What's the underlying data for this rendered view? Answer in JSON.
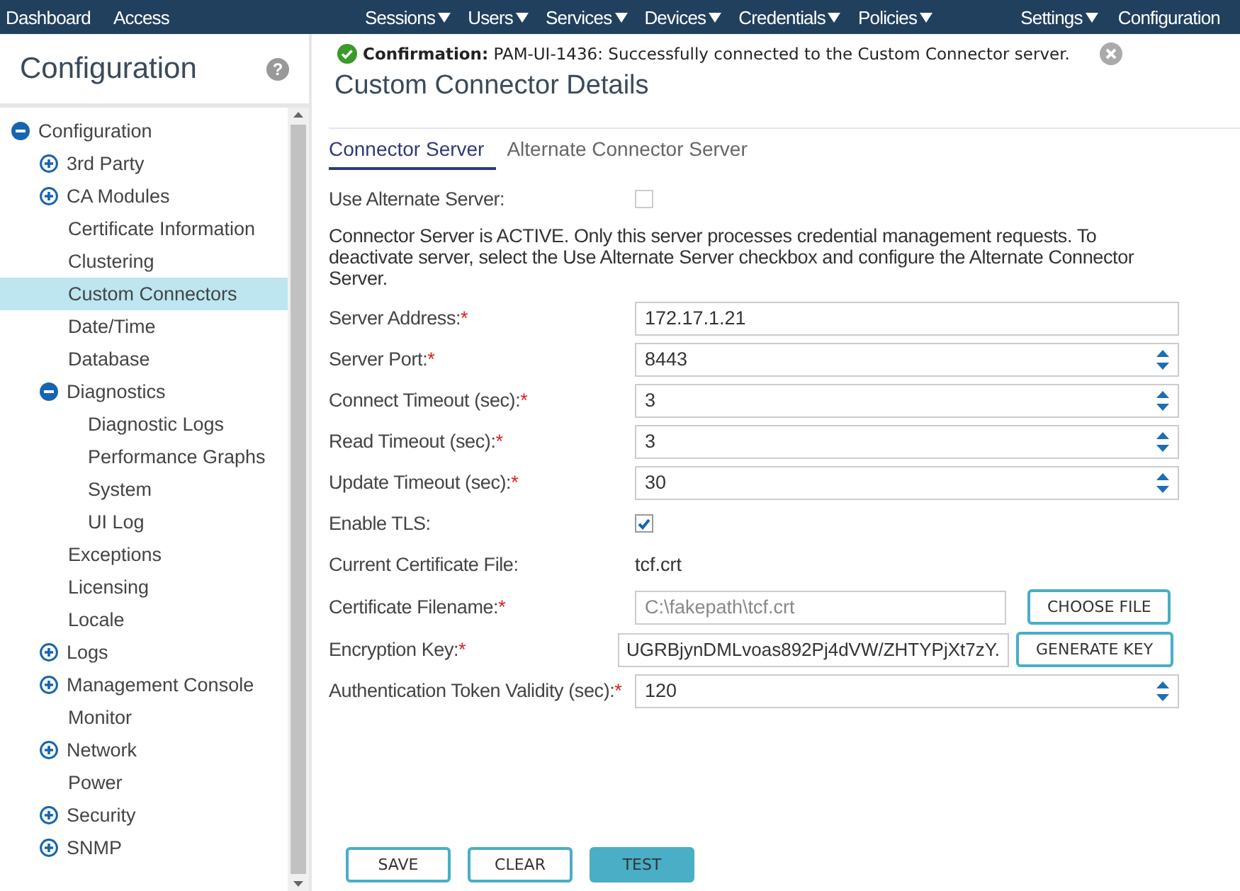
{
  "nav": {
    "left": [
      "Dashboard",
      "Access"
    ],
    "menus": [
      "Sessions",
      "Users",
      "Services",
      "Devices",
      "Credentials",
      "Policies"
    ],
    "right": [
      {
        "label": "Settings",
        "dropdown": true
      },
      {
        "label": "Configuration",
        "dropdown": false
      }
    ]
  },
  "sidebar": {
    "title": "Configuration",
    "help": "?",
    "tree": [
      {
        "label": "Configuration",
        "kind": "folder",
        "expanded": true,
        "selected": false,
        "children": [
          {
            "label": "3rd Party",
            "kind": "folder",
            "expanded": false,
            "selected": false
          },
          {
            "label": "CA Modules",
            "kind": "folder",
            "expanded": false,
            "selected": false
          },
          {
            "label": "Certificate Information",
            "kind": "leaf",
            "selected": false
          },
          {
            "label": "Clustering",
            "kind": "leaf",
            "selected": false
          },
          {
            "label": "Custom Connectors",
            "kind": "leaf",
            "selected": true
          },
          {
            "label": "Date/Time",
            "kind": "leaf",
            "selected": false
          },
          {
            "label": "Database",
            "kind": "leaf",
            "selected": false
          },
          {
            "label": "Diagnostics",
            "kind": "folder",
            "expanded": true,
            "selected": false,
            "children": [
              {
                "label": "Diagnostic Logs",
                "kind": "leaf",
                "selected": false
              },
              {
                "label": "Performance Graphs",
                "kind": "leaf",
                "selected": false
              },
              {
                "label": "System",
                "kind": "leaf",
                "selected": false
              },
              {
                "label": "UI Log",
                "kind": "leaf",
                "selected": false
              }
            ]
          },
          {
            "label": "Exceptions",
            "kind": "leaf",
            "selected": false
          },
          {
            "label": "Licensing",
            "kind": "leaf",
            "selected": false
          },
          {
            "label": "Locale",
            "kind": "leaf",
            "selected": false
          },
          {
            "label": "Logs",
            "kind": "folder",
            "expanded": false,
            "selected": false
          },
          {
            "label": "Management Console",
            "kind": "folder",
            "expanded": false,
            "selected": false
          },
          {
            "label": "Monitor",
            "kind": "leaf",
            "selected": false
          },
          {
            "label": "Network",
            "kind": "folder",
            "expanded": false,
            "selected": false
          },
          {
            "label": "Power",
            "kind": "leaf",
            "selected": false
          },
          {
            "label": "Security",
            "kind": "folder",
            "expanded": false,
            "selected": false
          },
          {
            "label": "SNMP",
            "kind": "folder",
            "expanded": false,
            "selected": false
          }
        ]
      }
    ]
  },
  "confirmation": {
    "text": "**Confirmation:** PAM-UI-1436: Successfully connected to the Custom Connector server."
  },
  "page_title": "Custom Connector Details",
  "tabs": [
    {
      "label": "Connector Server",
      "selected": true
    },
    {
      "label": "Alternate Connector Server",
      "selected": false
    }
  ],
  "fields": [
    {
      "kind": "checkbox",
      "label": "Use Alternate Server:",
      "checked": false
    },
    {
      "kind": "note",
      "text": "Connector Server is ACTIVE. Only this server processes credential management requests. To deactivate server, select the Use Alternate Server checkbox and configure the Alternate Connector Server."
    },
    {
      "kind": "text",
      "label": "Server Address:",
      "required_mark": "*",
      "value": "172.17.1.21"
    },
    {
      "kind": "spinner",
      "label": "Server Port:",
      "required_mark": "*",
      "value": "8443"
    },
    {
      "kind": "spinner",
      "label": "Connect Timeout (sec):",
      "required_mark": "*",
      "value": "3"
    },
    {
      "kind": "spinner",
      "label": "Read Timeout (sec):",
      "required_mark": "*",
      "value": "3"
    },
    {
      "kind": "spinner",
      "label": "Update Timeout (sec):",
      "required_mark": "*",
      "value": "30"
    },
    {
      "kind": "checkbox",
      "label": "Enable TLS:",
      "checked": true
    },
    {
      "kind": "static",
      "label": "Current Certificate File:",
      "value": "tcf.crt"
    },
    {
      "kind": "file",
      "label": "Certificate Filename:",
      "required_mark": "*",
      "value": "C:\\fakepath\\tcf.crt",
      "disabled": true,
      "button": "CHOOSE FILE"
    },
    {
      "kind": "key",
      "label": "Encryption Key:",
      "required_mark": "*",
      "value": "UGRBjynDMLvoas892Pj4dVW/ZHTYPjXt7zY.",
      "button": "GENERATE KEY"
    },
    {
      "kind": "spinner",
      "label": "Authentication Token Validity (sec):",
      "required_mark": "*",
      "value": "120"
    }
  ],
  "buttons": [
    {
      "label": "SAVE",
      "kind": "outline"
    },
    {
      "label": "CLEAR",
      "kind": "outline"
    },
    {
      "label": "TEST",
      "kind": "filled"
    }
  ]
}
